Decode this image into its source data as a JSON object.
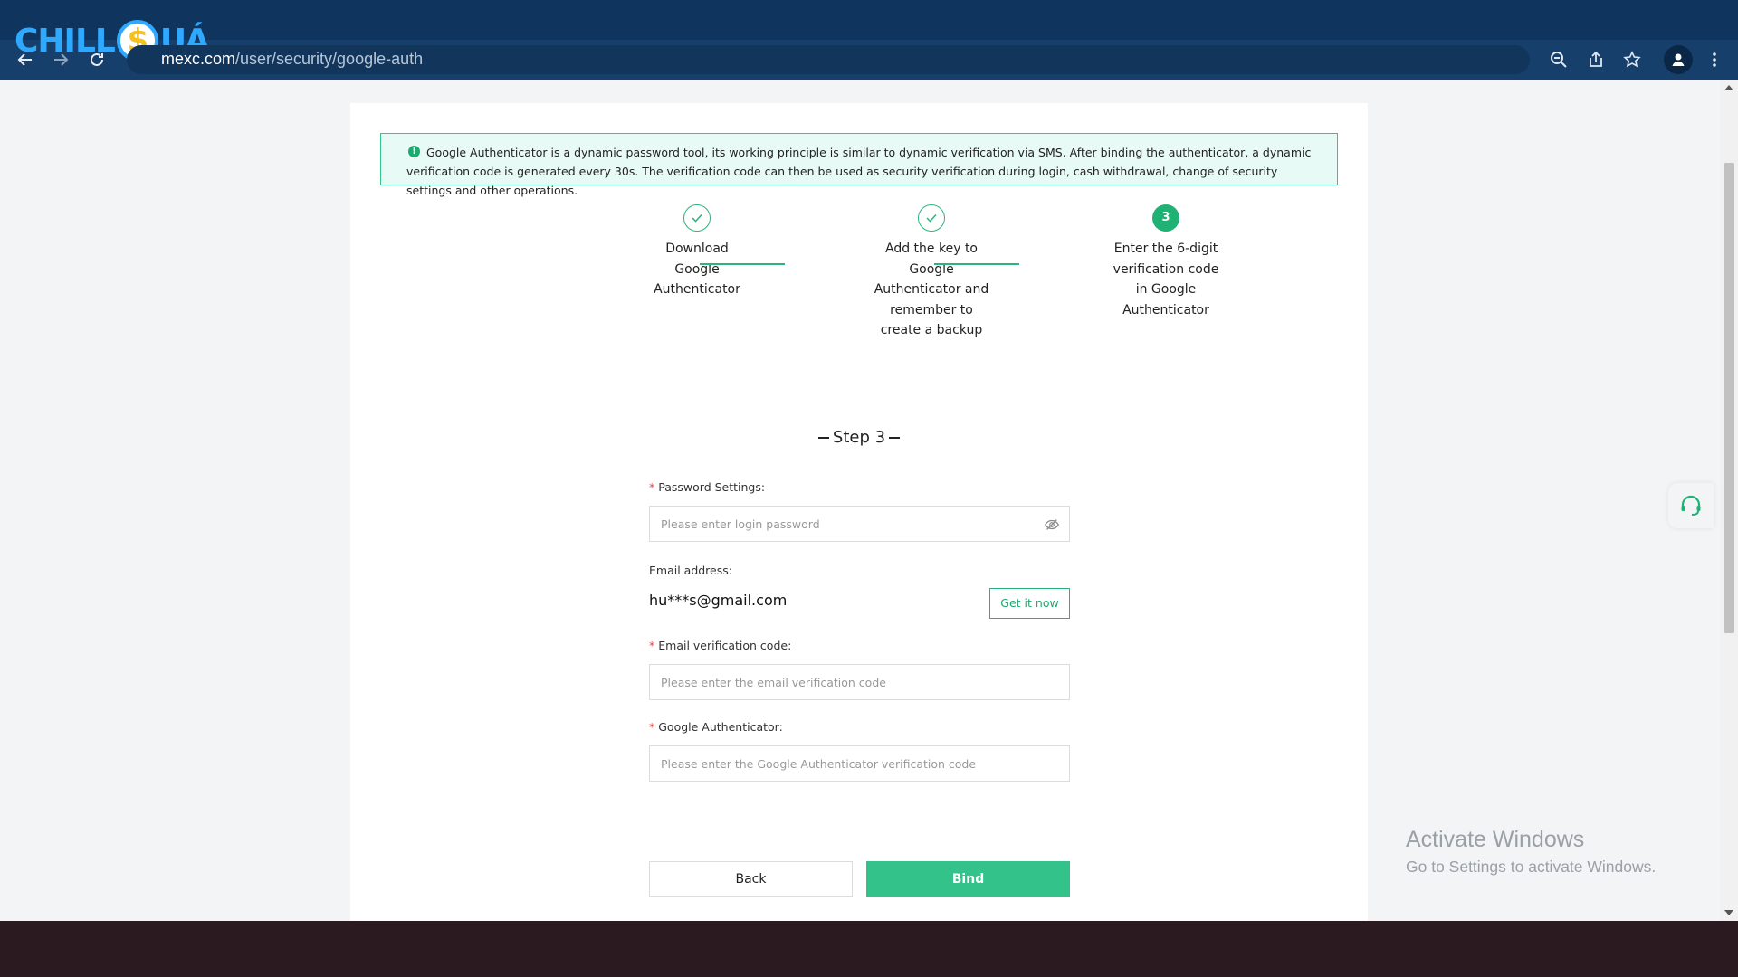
{
  "browser": {
    "url_host": "mexc.com",
    "url_path": "/user/security/google-auth"
  },
  "logo": {
    "left": "CHILL",
    "symbol": "$",
    "right": "UÁ"
  },
  "info_banner": {
    "text": "Google Authenticator is a dynamic password tool, its working principle is similar to dynamic verification via SMS. After binding the authenticator, a dynamic verification code is generated every 30s. The verification code can then be used as security verification during login, cash withdrawal, change of security settings and other operations."
  },
  "steps": [
    {
      "label": "Download Google Authenticator",
      "status": "done"
    },
    {
      "label": "Add the key to Google Authenticator and remember to create a backup",
      "status": "done"
    },
    {
      "label": "Enter the 6-digit verification code in Google Authenticator",
      "status": "current",
      "number": "3"
    }
  ],
  "step_heading": "Step 3",
  "form": {
    "password_label": "Password Settings:",
    "password_placeholder": "Please enter login password",
    "email_label": "Email address:",
    "email_value": "hu***s@gmail.com",
    "get_code_button": "Get it now",
    "email_code_label": "Email verification code:",
    "email_code_placeholder": "Please enter the email verification code",
    "ga_label": "Google Authenticator:",
    "ga_placeholder": "Please enter the Google Authenticator verification code",
    "back_button": "Back",
    "bind_button": "Bind"
  },
  "windows_watermark": {
    "title": "Activate Windows",
    "subtitle": "Go to Settings to activate Windows."
  },
  "colors": {
    "brand_green": "#32c28a",
    "chrome_blue": "#0f355f"
  }
}
